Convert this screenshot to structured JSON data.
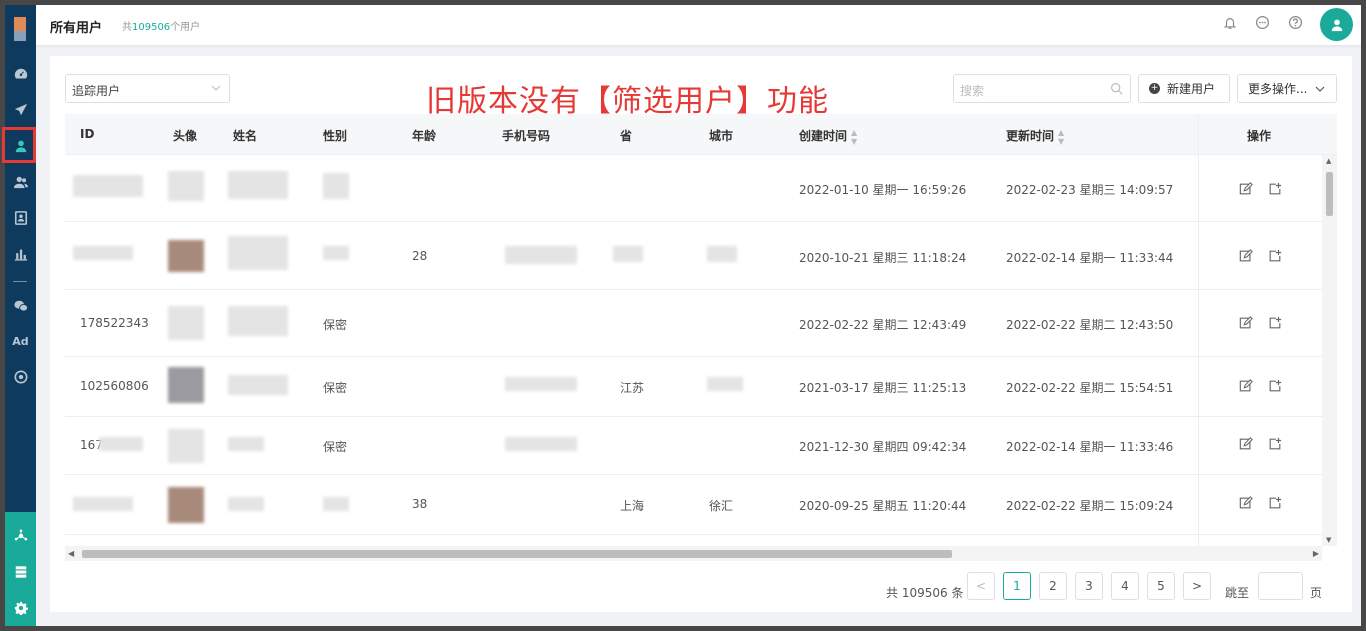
{
  "header": {
    "title": "所有用户",
    "count_prefix": "共",
    "count_value": "109506",
    "count_suffix": "个用户"
  },
  "toolbar": {
    "select_value": "追踪用户",
    "annotation": "旧版本没有【筛选用户】功能",
    "search_placeholder": "搜索",
    "new_user_label": "新建用户",
    "more_actions_label": "更多操作..."
  },
  "sidebar": {
    "ad_label": "Ad"
  },
  "table": {
    "columns": [
      "ID",
      "头像",
      "姓名",
      "性别",
      "年龄",
      "手机号码",
      "省",
      "城市",
      "创建时间",
      "更新时间",
      "操作"
    ],
    "rows": [
      {
        "id": "",
        "gender": "",
        "age": "",
        "province": "",
        "city": "",
        "created": "2022-01-10 星期一 16:59:26",
        "updated": "2022-02-23 星期三 14:09:57"
      },
      {
        "id": "",
        "gender": "",
        "age": "28",
        "province": "",
        "city": "",
        "created": "2020-10-21 星期三 11:18:24",
        "updated": "2022-02-14 星期一 11:33:44"
      },
      {
        "id": "178522343",
        "gender": "保密",
        "age": "",
        "province": "",
        "city": "",
        "created": "2022-02-22 星期二 12:43:49",
        "updated": "2022-02-22 星期二 12:43:50"
      },
      {
        "id": "102560806",
        "gender": "保密",
        "age": "",
        "province": "江苏",
        "city": "",
        "created": "2021-03-17 星期三 11:25:13",
        "updated": "2022-02-22 星期二 15:54:51"
      },
      {
        "id": "167",
        "gender": "保密",
        "age": "",
        "province": "",
        "city": "",
        "created": "2021-12-30 星期四 09:42:34",
        "updated": "2022-02-14 星期一 11:33:46"
      },
      {
        "id": "",
        "gender": "",
        "age": "38",
        "province": "上海",
        "city": "徐汇",
        "created": "2020-09-25 星期五 11:20:44",
        "updated": "2022-02-22 星期二 15:09:24"
      }
    ]
  },
  "pagination": {
    "total": "共 109506 条",
    "pages": [
      "1",
      "2",
      "3",
      "4",
      "5"
    ],
    "current": "1",
    "jump_label": "跳至",
    "page_suffix": "页",
    "prev": "<",
    "next": ">"
  },
  "colors": {
    "sidebar_bg": "#0e3b5d",
    "accent": "#1aaa9a",
    "annotation": "#e53935"
  }
}
